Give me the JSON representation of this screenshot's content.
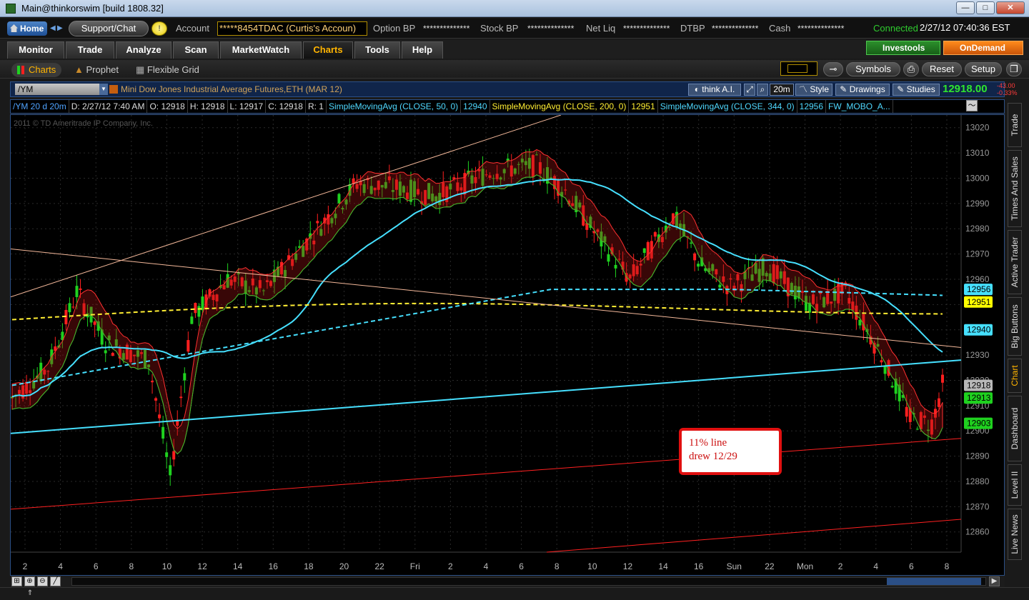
{
  "window": {
    "title": "Main@thinkorswim [build 1808.32]",
    "min": "—",
    "max": "□",
    "close": "✕"
  },
  "account_bar": {
    "home": "Home",
    "support": "Support/Chat",
    "bulb": "!",
    "account_label": "Account",
    "account_value": "*****8454TDAC (Curtis's Accoun)",
    "option_bp_label": "Option BP",
    "option_bp_value": "**************",
    "stock_bp_label": "Stock BP",
    "stock_bp_value": "**************",
    "net_liq_label": "Net Liq",
    "net_liq_value": "**************",
    "dtbp_label": "DTBP",
    "dtbp_value": "**************",
    "cash_label": "Cash",
    "cash_value": "**************",
    "status": "Connected",
    "clock": "2/27/12 07:40:36 EST"
  },
  "main_tabs": [
    "Monitor",
    "Trade",
    "Analyze",
    "Scan",
    "MarketWatch",
    "Charts",
    "Tools",
    "Help"
  ],
  "investools": "Investools",
  "ondemand": "OnDemand",
  "sub_tabs": {
    "charts": "Charts",
    "prophet": "Prophet",
    "grid": "Flexible Grid"
  },
  "right_tools": {
    "symbols": "Symbols",
    "reset": "Reset",
    "setup": "Setup"
  },
  "symbol_bar": {
    "symbol": "/YM",
    "description": "Mini Dow Jones Industrial Average Futures,ETH (MAR 12)",
    "think_ai": "think A.I.",
    "timeframe": "20m",
    "style": "Style",
    "drawings": "Drawings",
    "studies": "Studies",
    "last": "12918.00",
    "change": "-43.00",
    "change_pct": "-0.33%"
  },
  "study_header": [
    {
      "text": "/YM 20 d 20m",
      "color": "#4fa3ff"
    },
    {
      "text": "D: 2/27/12 7:40 AM",
      "color": "#dddddd"
    },
    {
      "text": "O: 12918",
      "color": "#dddddd"
    },
    {
      "text": "H: 12918",
      "color": "#dddddd"
    },
    {
      "text": "L: 12917",
      "color": "#dddddd"
    },
    {
      "text": "C: 12918",
      "color": "#dddddd"
    },
    {
      "text": "R: 1",
      "color": "#dddddd"
    },
    {
      "text": "SimpleMovingAvg (CLOSE, 50, 0)",
      "color": "#4fd8ff"
    },
    {
      "text": "12940",
      "color": "#4fd8ff"
    },
    {
      "text": "SimpleMovingAvg (CLOSE, 200, 0)",
      "color": "#ffee33"
    },
    {
      "text": "12951",
      "color": "#ffee33"
    },
    {
      "text": "SimpleMovingAvg (CLOSE, 344, 0)",
      "color": "#4fd8ff"
    },
    {
      "text": "12956",
      "color": "#4fd8ff"
    },
    {
      "text": "FW_MOBO_A...",
      "color": "#4fd8ff"
    }
  ],
  "chart_data": {
    "type": "candlestick",
    "watermark": "2011 © TD Ameritrade IP Company, Inc.",
    "ylim": [
      12852,
      13025
    ],
    "y_ticks": [
      13020,
      13010,
      13000,
      12990,
      12980,
      12970,
      12960,
      12950,
      12940,
      12930,
      12920,
      12910,
      12900,
      12890,
      12880,
      12870,
      12860
    ],
    "x_ticks": [
      "2",
      "4",
      "6",
      "8",
      "10",
      "12",
      "14",
      "16",
      "18",
      "20",
      "22",
      "Fri",
      "2",
      "4",
      "6",
      "8",
      "10",
      "12",
      "14",
      "16",
      "Sun",
      "22",
      "Mon",
      "2",
      "4",
      "6",
      "8"
    ],
    "price_labels": [
      {
        "text": "12956",
        "value": 12956,
        "bg": "#46e0ff"
      },
      {
        "text": "12951",
        "value": 12951,
        "bg": "#ffff00"
      },
      {
        "text": "12940",
        "value": 12940,
        "bg": "#46e0ff"
      },
      {
        "text": "12918",
        "value": 12918,
        "bg": "#b8b8b8"
      },
      {
        "text": "12913",
        "value": 12913,
        "bg": "#1fd11f"
      },
      {
        "text": "12903",
        "value": 12903,
        "bg": "#1fd11f"
      }
    ],
    "colors": {
      "up": "#1fd11f",
      "down": "#ff1f1f",
      "sma50": "#46e0ff",
      "sma200": "#ffee33",
      "sma344": "#46e0ff",
      "trendline_upper": "#f4b89a",
      "trendline_lower": "#f4b89a",
      "trend_support": "#46e0ff",
      "red_channel": "#ff2020"
    }
  },
  "annotation": {
    "line1": "11% line",
    "line2": "drew 12/29"
  },
  "right_sidebar": [
    "Trade",
    "Times And Sales",
    "Active Trader",
    "Big Buttons",
    "Chart",
    "Dashboard",
    "Level II",
    "Live News"
  ]
}
